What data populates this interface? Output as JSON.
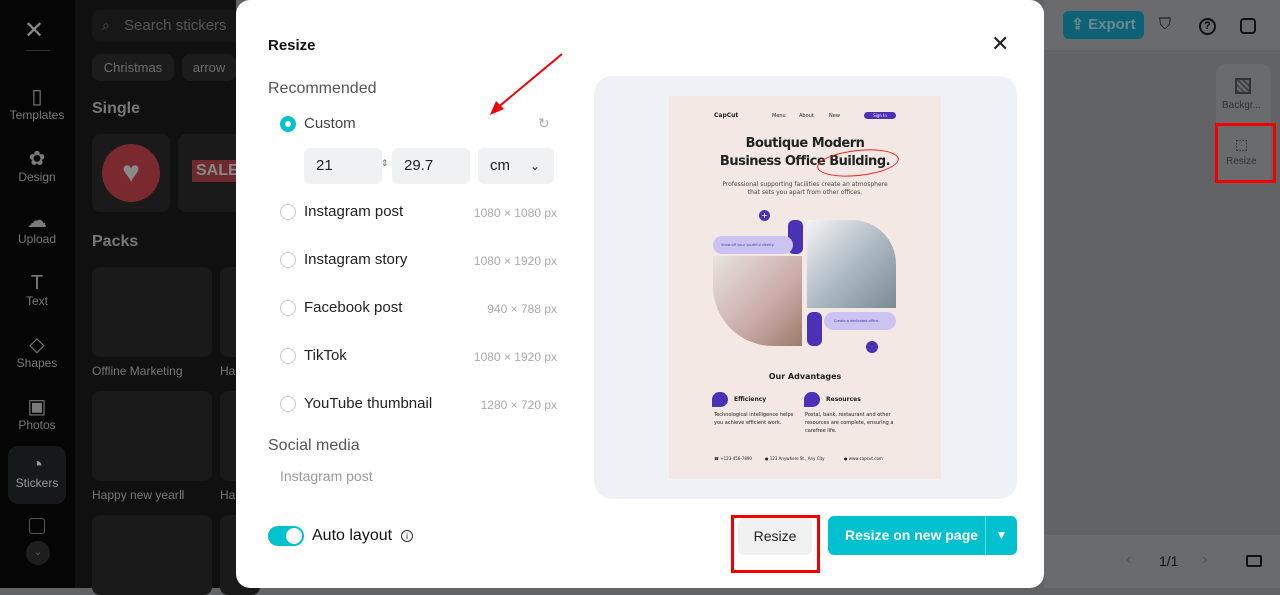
{
  "sidebar": {
    "items": [
      {
        "label": "Templates",
        "icon": "templates-icon"
      },
      {
        "label": "Design",
        "icon": "design-icon"
      },
      {
        "label": "Upload",
        "icon": "upload-icon"
      },
      {
        "label": "Text",
        "icon": "text-icon"
      },
      {
        "label": "Shapes",
        "icon": "shapes-icon"
      },
      {
        "label": "Photos",
        "icon": "photos-icon"
      },
      {
        "label": "Stickers",
        "icon": "stickers-icon",
        "active": true
      }
    ]
  },
  "panel": {
    "search_placeholder": "Search stickers",
    "chips": [
      "Christmas",
      "arrow"
    ],
    "single_title": "Single",
    "sale": "SALE",
    "packs_title": "Packs",
    "packs": [
      "Offline Marketing",
      "Happy new yearⅡ",
      "Ha",
      "Ha"
    ]
  },
  "topbar": {
    "export": "Export"
  },
  "right_tools": {
    "background": "Backgr...",
    "resize": "Resize"
  },
  "pagination": {
    "page": "1/1"
  },
  "modal": {
    "title": "Resize",
    "recommended": "Recommended",
    "custom": {
      "label": "Custom",
      "width": "21",
      "height": "29.7",
      "unit": "cm"
    },
    "options": [
      {
        "label": "Instagram post",
        "dims": "1080 × 1080 px"
      },
      {
        "label": "Instagram story",
        "dims": "1080 × 1920 px"
      },
      {
        "label": "Facebook post",
        "dims": "940 × 788 px"
      },
      {
        "label": "TikTok",
        "dims": "1080 × 1920 px"
      },
      {
        "label": "YouTube thumbnail",
        "dims": "1280 × 720 px"
      }
    ],
    "social_media": "Social media",
    "social_items": [
      "Instagram post"
    ],
    "auto_layout": "Auto layout",
    "auto_layout_on": true,
    "resize_button": "Resize",
    "resize_new_page": "Resize on new page",
    "accent": "#00c1cd"
  },
  "poster": {
    "brand": "CapCut",
    "nav": [
      "Menu",
      "About",
      "New"
    ],
    "signin": "Sign In",
    "headline1": "Boutique Modern",
    "headline2": "Business Office Building.",
    "sub1": "Professional supporting facilities create an atmosphere",
    "sub2": "that sets you apart from other offices.",
    "bubble1": "Show off your youthful vitality.",
    "bubble2": "Create a dedicated office.",
    "advantages": "Our Advantages",
    "f1_title": "Efficiency",
    "f1_text": "Technological intelligence helps you achieve efficient work.",
    "f2_title": "Resources",
    "f2_text": "Postal, bank, restaurant and other resources are complete, ensuring a carefree life.",
    "phone": "+123-456-7890",
    "address": "123 Anywhere St., Any City",
    "web": "www.capcut.com"
  }
}
